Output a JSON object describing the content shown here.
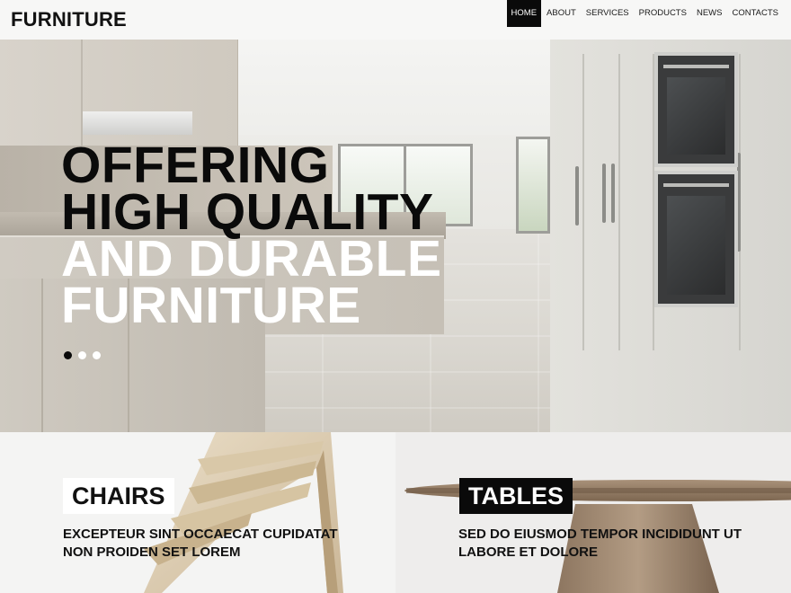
{
  "brand": {
    "logo": "FURNITURE"
  },
  "nav": {
    "items": [
      {
        "label": "HOME",
        "active": true
      },
      {
        "label": "ABOUT",
        "active": false
      },
      {
        "label": "SERVICES",
        "active": false
      },
      {
        "label": "PRODUCTS",
        "active": false
      },
      {
        "label": "NEWS",
        "active": false
      },
      {
        "label": "CONTACTS",
        "active": false
      }
    ]
  },
  "hero": {
    "lines_dark": [
      "OFFERING",
      "HIGH QUALITY"
    ],
    "lines_light": [
      "AND DURABLE",
      "FURNITURE"
    ],
    "slider": {
      "slide_count": 3,
      "active_index": 0
    }
  },
  "categories": [
    {
      "tag": "CHAIRS",
      "description": "EXCEPTEUR SINT OCCAECAT CUPIDATAT NON PROIDEN SET LOREM"
    },
    {
      "tag": "TABLES",
      "description": "SED DO EIUSMOD TEMPOR INCIDIDUNT UT LABORE ET DOLORE"
    }
  ],
  "colors": {
    "accent": "#0a0a0a",
    "nav_active_bg": "#0a0a0a",
    "nav_active_text": "#ffffff"
  }
}
